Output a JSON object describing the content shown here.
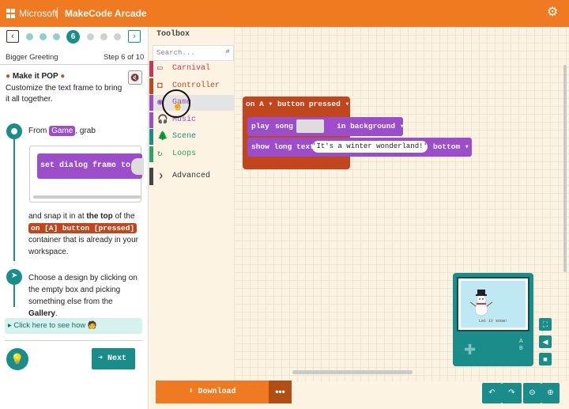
{
  "header": {
    "brand": "Microsoft",
    "title": "MakeCode Arcade",
    "settings_icon": "gear-icon"
  },
  "tutorial": {
    "current_step": "6",
    "name": "Bigger Greeting",
    "step_text": "Step 6 of 10",
    "make_it_pop_title": "Make it POP",
    "make_it_pop_body": "Customize the text frame to bring it all together.",
    "step1_prefix": "From",
    "step1_chip": "Game",
    "step1_suffix": ", grab",
    "preview_block": "set dialog frame to",
    "snap_text_1": "and snap it in at",
    "snap_bold": "the top",
    "snap_text_2": "of the",
    "snap_chip": "on [A] button [pressed]",
    "snap_text_3": "container that is already in your workspace.",
    "step2_text_1": "Choose a design by clicking on the empty box and picking something else from the",
    "step2_bold": "Gallery",
    "step2_text_2": ".",
    "see_how": "▸ Click here to see how",
    "next_label": "Next"
  },
  "toolbox": {
    "label": "Toolbox",
    "search_placeholder": "Search...",
    "categories": [
      {
        "label": "Carnival",
        "color": "#c8365e"
      },
      {
        "label": "Controller",
        "color": "#c1451d"
      },
      {
        "label": "Game",
        "color": "#9b4dca"
      },
      {
        "label": "Music",
        "color": "#9b4dca"
      },
      {
        "label": "Scene",
        "color": "#1a8d8a"
      },
      {
        "label": "Loops",
        "color": "#30a06a"
      }
    ],
    "advanced": "Advanced"
  },
  "workspace": {
    "on_button": {
      "prefix": "on",
      "button": "A",
      "label": "button",
      "event": "pressed"
    },
    "play_song": {
      "play": "play",
      "song": "song",
      "mode": "in background"
    },
    "show_text": {
      "label": "show long text",
      "text": "It's a winter wonderland!",
      "position": "bottom"
    }
  },
  "simulator": {
    "screen_text": "Let it snow!",
    "a_label": "A",
    "b_label": "B"
  },
  "footer": {
    "download_label": "Download",
    "more_label": "•••"
  }
}
